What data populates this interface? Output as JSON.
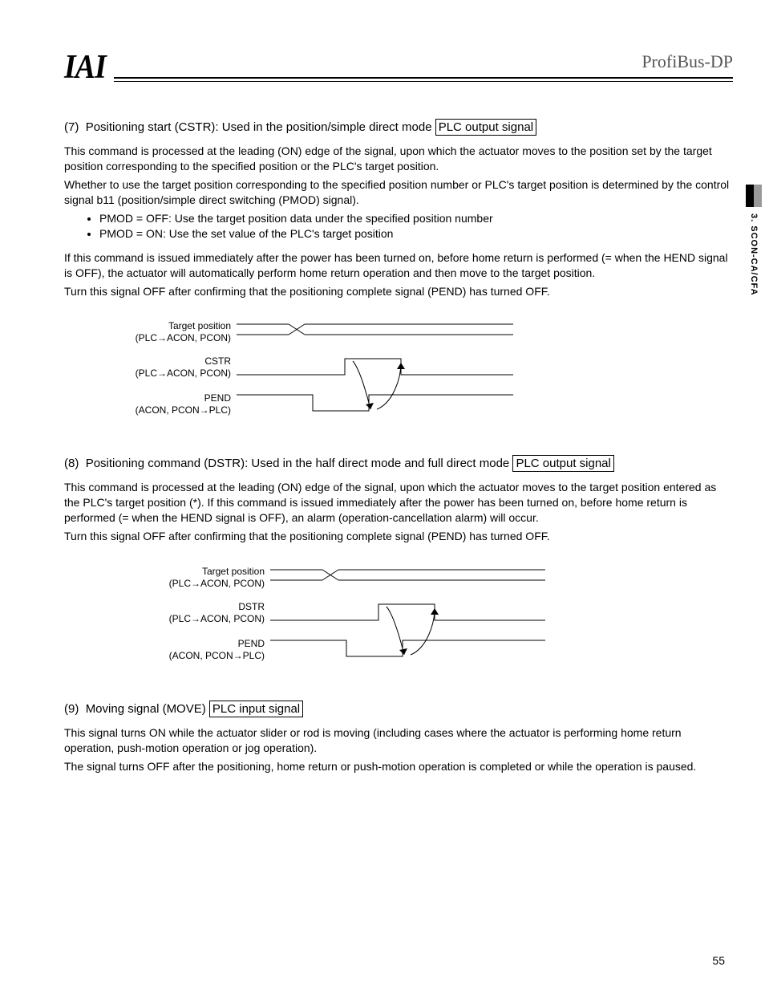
{
  "header": {
    "logo_text": "IAI",
    "brand_text": "ProfiBus-DP"
  },
  "side_tab": "3. SCON-CA/CFA",
  "section7": {
    "num": "(7)",
    "title": "Positioning start (CSTR): Used in the position/simple direct mode",
    "badge": "PLC output signal",
    "para1": "This command is processed at the leading (ON) edge of the signal, upon which the actuator moves to the position set by the target position corresponding to the specified position or the PLC's target position.",
    "para2": "Whether to use the target position corresponding to the specified position number or PLC's target position is determined by the control signal b11 (position/simple direct switching (PMOD) signal).",
    "bullet1": "PMOD = OFF: Use the target position data under the specified position number",
    "bullet2": "PMOD = ON: Use the set value of the PLC's target position",
    "para3": "If this command is issued immediately after the power has been turned on, before home return is performed (= when the HEND signal is OFF), the actuator will automatically perform home return operation and then move to the target position.",
    "para4": "Turn this signal OFF after confirming that the positioning complete signal (PEND) has turned OFF.",
    "diagram": {
      "row1a": "Target position",
      "row1b": "(PLC→ACON, PCON)",
      "row2a": "CSTR",
      "row2b": "(PLC→ACON, PCON)",
      "row3a": "PEND",
      "row3b": "(ACON, PCON→PLC)"
    }
  },
  "section8": {
    "num": "(8)",
    "title": "Positioning command (DSTR): Used in the half direct mode and full direct mode",
    "badge": "PLC output signal",
    "para1": "This command is processed at the leading (ON) edge of the signal, upon which the actuator moves to the target position entered as the PLC's target position (*). If this command is issued immediately after the power has been turned on, before home return is performed (= when the HEND signal is OFF), an alarm (operation-cancellation alarm) will occur.",
    "para2": "Turn this signal OFF after confirming that the positioning complete signal (PEND) has turned OFF.",
    "diagram": {
      "row1a": "Target position",
      "row1b": "(PLC→ACON, PCON)",
      "row2a": "DSTR",
      "row2b": "(PLC→ACON, PCON)",
      "row3a": "PEND",
      "row3b": "(ACON, PCON→PLC)"
    }
  },
  "section9": {
    "num": "(9)",
    "title": "Moving signal (MOVE)",
    "badge": "PLC input signal",
    "para1": "This signal turns ON while the actuator slider or rod is moving (including cases where the actuator is performing home return operation, push-motion operation or jog operation).",
    "para2": "The signal turns OFF after the positioning, home return or push-motion operation is completed or while the operation is paused."
  },
  "page_number": "55",
  "chart_data": [
    {
      "type": "timing-diagram",
      "title": "CSTR timing",
      "signals": [
        {
          "name": "Target position",
          "source": "PLC→ACON, PCON",
          "shape": "level with X transition then stable"
        },
        {
          "name": "CSTR",
          "source": "PLC→ACON, PCON",
          "shape": "low, pulse high, return low"
        },
        {
          "name": "PEND",
          "source": "ACON, PCON→PLC",
          "shape": "high, drop low after CSTR rising edge, return high (arrow feedback)"
        }
      ]
    },
    {
      "type": "timing-diagram",
      "title": "DSTR timing",
      "signals": [
        {
          "name": "Target position",
          "source": "PLC→ACON, PCON",
          "shape": "level with X transition then stable"
        },
        {
          "name": "DSTR",
          "source": "PLC→ACON, PCON",
          "shape": "low, pulse high, return low"
        },
        {
          "name": "PEND",
          "source": "ACON, PCON→PLC",
          "shape": "high, drop low after DSTR rising edge, return high (arrow feedback)"
        }
      ]
    }
  ]
}
